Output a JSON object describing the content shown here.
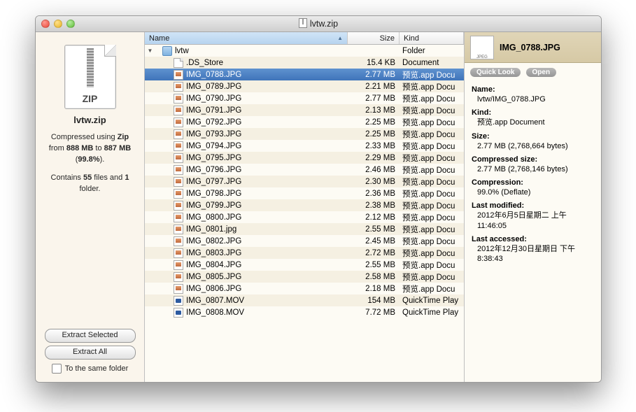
{
  "window": {
    "title": "lvtw.zip"
  },
  "left": {
    "filename": "lvtw.zip",
    "zip_badge": "ZIP",
    "summary_1a": "Compressed using ",
    "summary_1b": "Zip",
    "summary_2a": "from ",
    "summary_2b": "888 MB",
    "summary_2c": " to ",
    "summary_2d": "887 MB",
    "summary_3a": "(",
    "summary_3b": "99.8%",
    "summary_3c": ").",
    "summary_4a": "Contains ",
    "summary_4b": "55",
    "summary_4c": " files and ",
    "summary_4d": "1",
    "summary_4e": " folder.",
    "btn_extract_selected": "Extract Selected",
    "btn_extract_all": "Extract All",
    "chk_same_folder": "To the same folder"
  },
  "columns": {
    "name": "Name",
    "size": "Size",
    "kind": "Kind"
  },
  "rows": [
    {
      "indent": 0,
      "disclosure": "▼",
      "icon": "folder",
      "name": "lvtw",
      "size": "",
      "kind": "Folder"
    },
    {
      "indent": 1,
      "icon": "doc",
      "name": ".DS_Store",
      "size": "15.4 KB",
      "kind": "Document"
    },
    {
      "indent": 1,
      "icon": "jpeg",
      "name": "IMG_0788.JPG",
      "size": "2.77 MB",
      "kind": "预览.app Docu",
      "selected": true
    },
    {
      "indent": 1,
      "icon": "jpeg",
      "name": "IMG_0789.JPG",
      "size": "2.21 MB",
      "kind": "预览.app Docu"
    },
    {
      "indent": 1,
      "icon": "jpeg",
      "name": "IMG_0790.JPG",
      "size": "2.77 MB",
      "kind": "预览.app Docu"
    },
    {
      "indent": 1,
      "icon": "jpeg",
      "name": "IMG_0791.JPG",
      "size": "2.13 MB",
      "kind": "预览.app Docu"
    },
    {
      "indent": 1,
      "icon": "jpeg",
      "name": "IMG_0792.JPG",
      "size": "2.25 MB",
      "kind": "预览.app Docu"
    },
    {
      "indent": 1,
      "icon": "jpeg",
      "name": "IMG_0793.JPG",
      "size": "2.25 MB",
      "kind": "预览.app Docu"
    },
    {
      "indent": 1,
      "icon": "jpeg",
      "name": "IMG_0794.JPG",
      "size": "2.33 MB",
      "kind": "预览.app Docu"
    },
    {
      "indent": 1,
      "icon": "jpeg",
      "name": "IMG_0795.JPG",
      "size": "2.29 MB",
      "kind": "预览.app Docu"
    },
    {
      "indent": 1,
      "icon": "jpeg",
      "name": "IMG_0796.JPG",
      "size": "2.46 MB",
      "kind": "预览.app Docu"
    },
    {
      "indent": 1,
      "icon": "jpeg",
      "name": "IMG_0797.JPG",
      "size": "2.30 MB",
      "kind": "预览.app Docu"
    },
    {
      "indent": 1,
      "icon": "jpeg",
      "name": "IMG_0798.JPG",
      "size": "2.36 MB",
      "kind": "预览.app Docu"
    },
    {
      "indent": 1,
      "icon": "jpeg",
      "name": "IMG_0799.JPG",
      "size": "2.38 MB",
      "kind": "预览.app Docu"
    },
    {
      "indent": 1,
      "icon": "jpeg",
      "name": "IMG_0800.JPG",
      "size": "2.12 MB",
      "kind": "预览.app Docu"
    },
    {
      "indent": 1,
      "icon": "jpeg",
      "name": "IMG_0801.jpg",
      "size": "2.55 MB",
      "kind": "预览.app Docu"
    },
    {
      "indent": 1,
      "icon": "jpeg",
      "name": "IMG_0802.JPG",
      "size": "2.45 MB",
      "kind": "预览.app Docu"
    },
    {
      "indent": 1,
      "icon": "jpeg",
      "name": "IMG_0803.JPG",
      "size": "2.72 MB",
      "kind": "预览.app Docu"
    },
    {
      "indent": 1,
      "icon": "jpeg",
      "name": "IMG_0804.JPG",
      "size": "2.55 MB",
      "kind": "预览.app Docu"
    },
    {
      "indent": 1,
      "icon": "jpeg",
      "name": "IMG_0805.JPG",
      "size": "2.58 MB",
      "kind": "预览.app Docu"
    },
    {
      "indent": 1,
      "icon": "jpeg",
      "name": "IMG_0806.JPG",
      "size": "2.18 MB",
      "kind": "预览.app Docu"
    },
    {
      "indent": 1,
      "icon": "mov",
      "name": "IMG_0807.MOV",
      "size": "154 MB",
      "kind": "QuickTime Play"
    },
    {
      "indent": 1,
      "icon": "mov",
      "name": "IMG_0808.MOV",
      "size": "7.72 MB",
      "kind": "QuickTime Play"
    }
  ],
  "detail": {
    "title": "IMG_0788.JPG",
    "quick_look": "Quick Look",
    "open": "Open",
    "k_name": "Name:",
    "v_name": "lvtw/IMG_0788.JPG",
    "k_kind": "Kind:",
    "v_kind": "预览.app Document",
    "k_size": "Size:",
    "v_size": "2.77 MB (2,768,664 bytes)",
    "k_csize": "Compressed size:",
    "v_csize": "2.77 MB (2,768,146 bytes)",
    "k_comp": "Compression:",
    "v_comp": "99.0% (Deflate)",
    "k_mod": "Last modified:",
    "v_mod": "2012年6月5日星期二 上午11:46:05",
    "k_acc": "Last accessed:",
    "v_acc": "2012年12月30日星期日 下午8:38:43"
  }
}
